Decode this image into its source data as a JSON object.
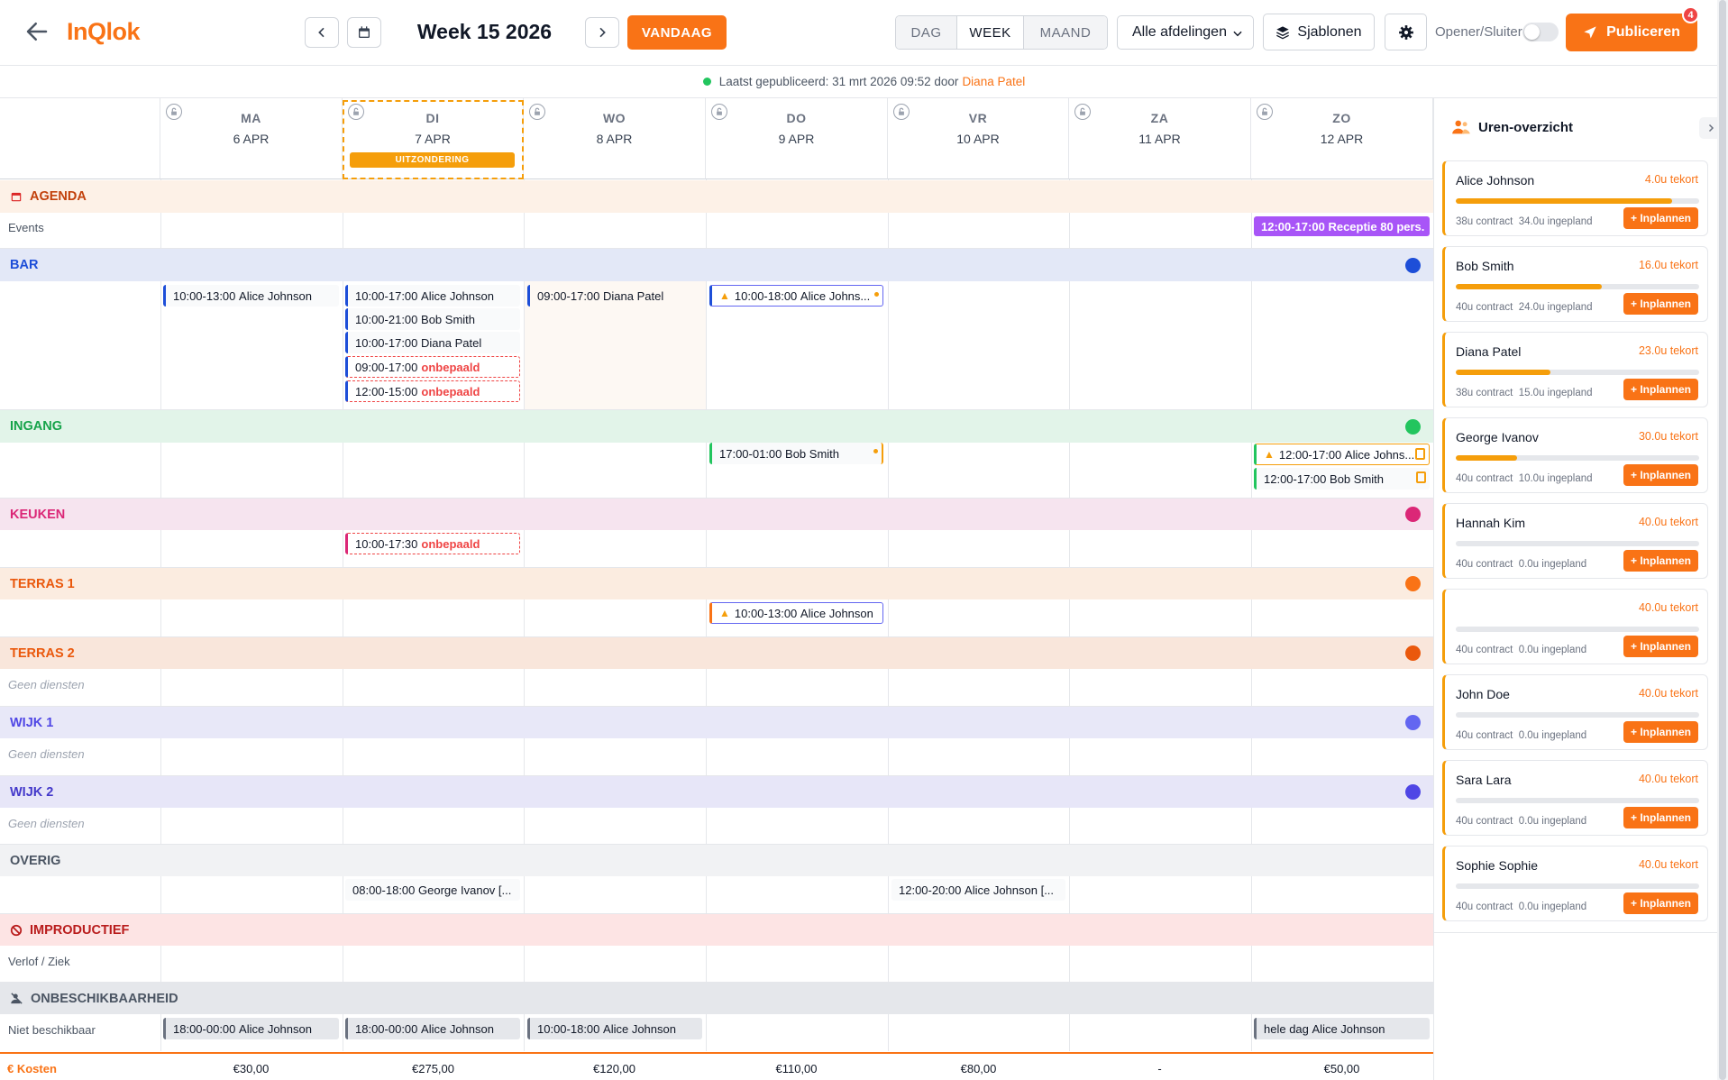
{
  "app": {
    "logo": "InQlok"
  },
  "header": {
    "week_title": "Week 15 2026",
    "today_label": "VANDAAG",
    "views": [
      "DAG",
      "WEEK",
      "MAAND"
    ],
    "active_view": "WEEK",
    "department_select": "Alle afdelingen",
    "templates_label": "Sjablonen",
    "opener_label": "Opener/Sluiter",
    "opener_on": false,
    "publish_label": "Publiceren",
    "publish_badge": "4"
  },
  "published": {
    "text": "Laatst gepubliceerd: 31 mrt 2026 09:52 door",
    "by": "Diana Patel"
  },
  "days": [
    {
      "name": "MA",
      "date": "6 APR"
    },
    {
      "name": "DI",
      "date": "7 APR",
      "exception": "UITZONDERING"
    },
    {
      "name": "WO",
      "date": "8 APR"
    },
    {
      "name": "DO",
      "date": "9 APR"
    },
    {
      "name": "VR",
      "date": "10 APR"
    },
    {
      "name": "ZA",
      "date": "11 APR"
    },
    {
      "name": "ZO",
      "date": "12 APR"
    }
  ],
  "sections": {
    "agenda": {
      "label": "AGENDA",
      "row_label": "Events"
    },
    "bar": {
      "label": "BAR",
      "color": "#1d4ed8"
    },
    "ingang": {
      "label": "INGANG",
      "color": "#16a34a"
    },
    "keuken": {
      "label": "KEUKEN",
      "color": "#db2777"
    },
    "terras1": {
      "label": "TERRAS 1",
      "color": "#f97316"
    },
    "terras2": {
      "label": "TERRAS 2",
      "color": "#ea580c",
      "empty": "Geen diensten"
    },
    "wijk1": {
      "label": "WIJK 1",
      "color": "#6366f1",
      "empty": "Geen diensten"
    },
    "wijk2": {
      "label": "WIJK 2",
      "color": "#4f46e5",
      "empty": "Geen diensten"
    },
    "overig": {
      "label": "OVERIG"
    },
    "improductief": {
      "label": "IMPRODUCTIEF",
      "row_label": "Verlof / Ziek"
    },
    "onbeschikbaarheid": {
      "label": "ONBESCHIKBAARHEID",
      "row_label": "Niet beschikbaar"
    }
  },
  "shifts": {
    "event_zo": {
      "time": "12:00-17:00",
      "name": "Receptie 80 pers."
    },
    "bar_ma_1": {
      "time": "10:00-13:00",
      "name": "Alice Johnson"
    },
    "bar_di_1": {
      "time": "10:00-17:00",
      "name": "Alice Johnson"
    },
    "bar_di_2": {
      "time": "10:00-21:00",
      "name": "Bob Smith"
    },
    "bar_di_3": {
      "time": "10:00-17:00",
      "name": "Diana Patel"
    },
    "bar_di_4": {
      "time": "09:00-17:00",
      "name": "onbepaald"
    },
    "bar_di_5": {
      "time": "12:00-15:00",
      "name": "onbepaald"
    },
    "bar_wo_1": {
      "time": "09:00-17:00",
      "name": "Diana Patel"
    },
    "bar_do_1": {
      "time": "10:00-18:00",
      "name": "Alice Johns..."
    },
    "ing_do_1": {
      "time": "17:00-01:00",
      "name": "Bob Smith"
    },
    "ing_zo_1": {
      "time": "12:00-17:00",
      "name": "Alice Johns..."
    },
    "ing_zo_2": {
      "time": "12:00-17:00",
      "name": "Bob Smith"
    },
    "keu_di_1": {
      "time": "10:00-17:30",
      "name": "onbepaald"
    },
    "ter_do_1": {
      "time": "10:00-13:00",
      "name": "Alice Johnson"
    },
    "ove_di_1": {
      "time": "08:00-18:00",
      "name": "George Ivanov [..."
    },
    "ove_vr_1": {
      "time": "12:00-20:00",
      "name": "Alice Johnson [..."
    },
    "onb_ma": {
      "time": "18:00-00:00",
      "name": "Alice Johnson"
    },
    "onb_di": {
      "time": "18:00-00:00",
      "name": "Alice Johnson"
    },
    "onb_wo": {
      "time": "10:00-18:00",
      "name": "Alice Johnson"
    },
    "onb_zo": {
      "time": "hele dag",
      "name": "Alice Johnson"
    }
  },
  "costs": {
    "label": "€ Kosten",
    "values": [
      "€30,00",
      "€275,00",
      "€120,00",
      "€110,00",
      "€80,00",
      "-",
      "€50,00"
    ]
  },
  "sidebar": {
    "title": "Uren-overzicht",
    "action_label": "+ Inplannen",
    "employees": [
      {
        "name": "Alice Johnson",
        "shortage": "4.0u tekort",
        "contract": "38u contract",
        "planned": "34.0u ingepland",
        "progress": 0.89
      },
      {
        "name": "Bob Smith",
        "shortage": "16.0u tekort",
        "contract": "40u contract",
        "planned": "24.0u ingepland",
        "progress": 0.6
      },
      {
        "name": "Diana Patel",
        "shortage": "23.0u tekort",
        "contract": "38u contract",
        "planned": "15.0u ingepland",
        "progress": 0.39
      },
      {
        "name": "George Ivanov",
        "shortage": "30.0u tekort",
        "contract": "40u contract",
        "planned": "10.0u ingepland",
        "progress": 0.25
      },
      {
        "name": "Hannah Kim",
        "shortage": "40.0u tekort",
        "contract": "40u contract",
        "planned": "0.0u ingepland",
        "progress": 0
      },
      {
        "name": "",
        "shortage": "40.0u tekort",
        "contract": "40u contract",
        "planned": "0.0u ingepland",
        "progress": 0
      },
      {
        "name": "John Doe",
        "shortage": "40.0u tekort",
        "contract": "40u contract",
        "planned": "0.0u ingepland",
        "progress": 0
      },
      {
        "name": "Sara Lara",
        "shortage": "40.0u tekort",
        "contract": "40u contract",
        "planned": "0.0u ingepland",
        "progress": 0
      },
      {
        "name": "Sophie Sophie",
        "shortage": "40.0u tekort",
        "contract": "40u contract",
        "planned": "0.0u ingepland",
        "progress": 0
      }
    ]
  },
  "colors": {
    "accent": "#f97316",
    "warning": "#f59e0b",
    "danger": "#ef4444",
    "event": "#a855f7"
  }
}
